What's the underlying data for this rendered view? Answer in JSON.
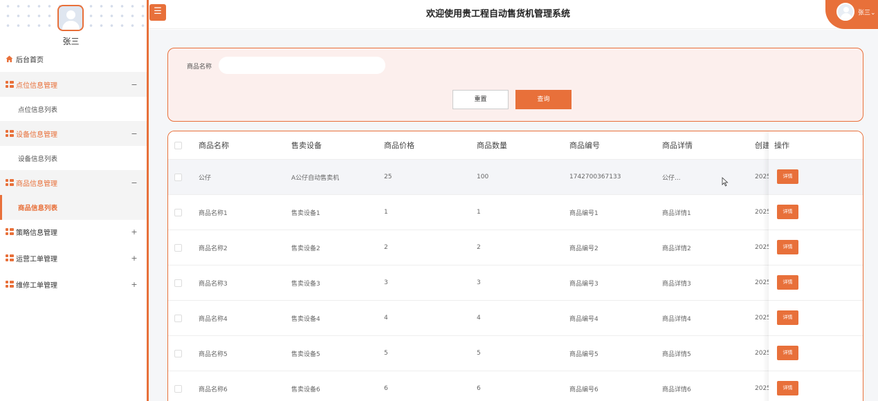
{
  "sidebar": {
    "user_name": "张三",
    "items": [
      {
        "label": "后台首页"
      },
      {
        "label": "点位信息管理",
        "toggle": "−"
      },
      {
        "label": "点位信息列表"
      },
      {
        "label": "设备信息管理",
        "toggle": "−"
      },
      {
        "label": "设备信息列表"
      },
      {
        "label": "商品信息管理",
        "toggle": "−"
      },
      {
        "label": "商品信息列表"
      },
      {
        "label": "策略信息管理",
        "toggle": "+"
      },
      {
        "label": "运营工单管理",
        "toggle": "+"
      },
      {
        "label": "维修工单管理",
        "toggle": "+"
      }
    ]
  },
  "header": {
    "menu_icon": "☰",
    "title": "欢迎使用贵工程自动售货机管理系统",
    "user_name": "张三⌄"
  },
  "search": {
    "label": "商品名称",
    "value": "",
    "placeholder": "",
    "reset_label": "重置",
    "query_label": "查询"
  },
  "table": {
    "columns": [
      "商品名称",
      "售卖设备",
      "商品价格",
      "商品数量",
      "商品编号",
      "商品详情",
      "创建",
      "操作"
    ],
    "detail_label": "详情",
    "rows": [
      [
        "公仔",
        "A公仔自动售卖机",
        "25",
        "100",
        "1742700367133",
        "公仔...",
        "2025"
      ],
      [
        "商品名称1",
        "售卖设备1",
        "1",
        "1",
        "商品编号1",
        "商品详情1",
        "2025"
      ],
      [
        "商品名称2",
        "售卖设备2",
        "2",
        "2",
        "商品编号2",
        "商品详情2",
        "2025"
      ],
      [
        "商品名称3",
        "售卖设备3",
        "3",
        "3",
        "商品编号3",
        "商品详情3",
        "2025"
      ],
      [
        "商品名称4",
        "售卖设备4",
        "4",
        "4",
        "商品编号4",
        "商品详情4",
        "2025"
      ],
      [
        "商品名称5",
        "售卖设备5",
        "5",
        "5",
        "商品编号5",
        "商品详情5",
        "2025"
      ],
      [
        "商品名称6",
        "售卖设备6",
        "6",
        "6",
        "商品编号6",
        "商品详情6",
        "2025"
      ]
    ]
  },
  "colors": {
    "accent": "#e8703a",
    "panel_bg": "#fcefed"
  }
}
